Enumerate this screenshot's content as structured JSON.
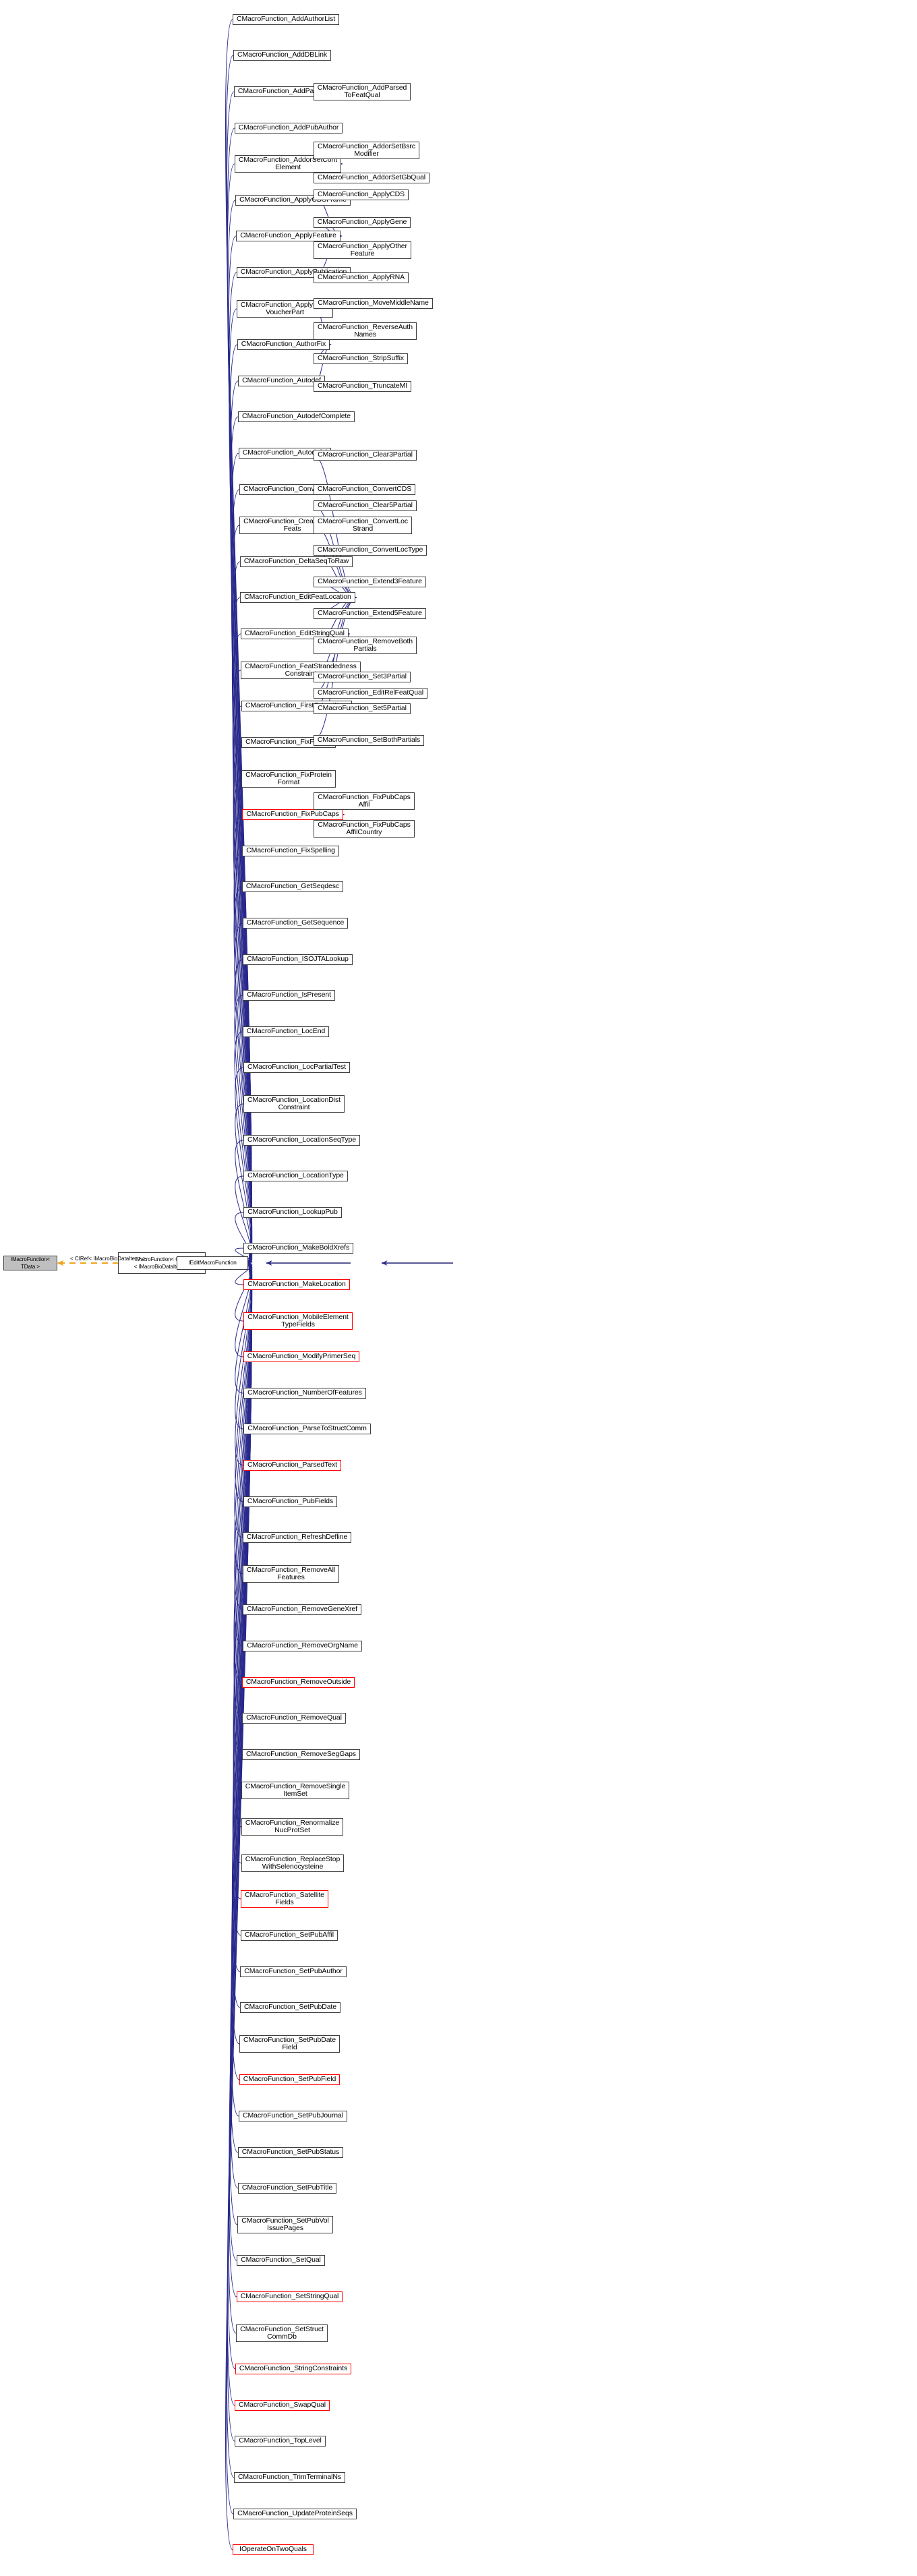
{
  "diagram": {
    "type": "inheritance-graph",
    "root": "IEditMacroFunction",
    "colors": {
      "node_border": "#404040",
      "node_fill": "#ffffff",
      "highlight_border": "#ff0000",
      "template_fill": "#bfbfbf",
      "inherit_edge": "#29298c",
      "usage_edge": "#f2a21c",
      "background": "#ffffff"
    },
    "edge_label": "< CIRef< IMacroBioDataIter > >",
    "base_chain": [
      {
        "label": "IMacroFunction< TData >",
        "style": "template"
      },
      {
        "label": "IMacroFunction< CIRef\n< IMacroBioDataIter > >",
        "style": "plain"
      },
      {
        "label": "IEditMacroFunction",
        "style": "plain"
      }
    ],
    "column1": [
      "CMacroFunction_AddAuthorList",
      "CMacroFunction_AddDBLink",
      "CMacroFunction_AddParsedText",
      "CMacroFunction_AddPubAuthor",
      "CMacroFunction_AddorSetCont\nElement",
      "CMacroFunction_ApplyCDSFrame",
      "CMacroFunction_ApplyFeature",
      "CMacroFunction_ApplyPublication",
      "CMacroFunction_ApplyStruc\nVoucherPart",
      "CMacroFunction_AuthorFix",
      "CMacroFunction_Autodef",
      "CMacroFunction_AutodefComplete",
      "CMacroFunction_AutodefId",
      "CMacroFunction_ConvertFeature",
      "CMacroFunction_CreateProtein\nFeats",
      "CMacroFunction_DeltaSeqToRaw",
      "CMacroFunction_EditFeatLocation",
      "CMacroFunction_EditStringQual",
      "CMacroFunction_FeatStrandedness\nConstraint",
      "CMacroFunction_FirstOrLastItem",
      "CMacroFunction_FixFormat",
      "CMacroFunction_FixProtein\nFormat",
      "CMacroFunction_FixPubCaps",
      "CMacroFunction_FixSpelling",
      "CMacroFunction_GetSeqdesc",
      "CMacroFunction_GetSequence",
      "CMacroFunction_ISOJTALookup",
      "CMacroFunction_IsPresent",
      "CMacroFunction_LocEnd",
      "CMacroFunction_LocPartialTest",
      "CMacroFunction_LocationDist\nConstraint",
      "CMacroFunction_LocationSeqType",
      "CMacroFunction_LocationType",
      "CMacroFunction_LookupPub",
      "CMacroFunction_MakeBoldXrefs",
      "CMacroFunction_MakeLocation",
      "CMacroFunction_MobileElement\nTypeFields",
      "CMacroFunction_ModifyPrimerSeq",
      "CMacroFunction_NumberOfFeatures",
      "CMacroFunction_ParseToStructComm",
      "CMacroFunction_ParsedText",
      "CMacroFunction_PubFields",
      "CMacroFunction_RefreshDefline",
      "CMacroFunction_RemoveAll\nFeatures",
      "CMacroFunction_RemoveGeneXref",
      "CMacroFunction_RemoveOrgName",
      "CMacroFunction_RemoveOutside",
      "CMacroFunction_RemoveQual",
      "CMacroFunction_RemoveSegGaps",
      "CMacroFunction_RemoveSingle\nItemSet",
      "CMacroFunction_Renormalize\nNucProtSet",
      "CMacroFunction_ReplaceStop\nWithSelenocysteine",
      "CMacroFunction_Satellite\nFields",
      "CMacroFunction_SetPubAffil",
      "CMacroFunction_SetPubAuthor",
      "CMacroFunction_SetPubDate",
      "CMacroFunction_SetPubDate\nField",
      "CMacroFunction_SetPubField",
      "CMacroFunction_SetPubJournal",
      "CMacroFunction_SetPubStatus",
      "CMacroFunction_SetPubTitle",
      "CMacroFunction_SetPubVol\nIssuePages",
      "CMacroFunction_SetQual",
      "CMacroFunction_SetStringQual",
      "CMacroFunction_SetStruct\nCommDb",
      "CMacroFunction_StringConstraints",
      "CMacroFunction_SwapQual",
      "CMacroFunction_TopLevel",
      "CMacroFunction_TrimTerminalNs",
      "CMacroFunction_UpdateProteinSeqs",
      "IOperateOnTwoQuals"
    ],
    "column1_red": [
      "CMacroFunction_FixPubCaps",
      "CMacroFunction_MakeLocation",
      "CMacroFunction_MobileElement\nTypeFields",
      "CMacroFunction_ModifyPrimerSeq",
      "CMacroFunction_ParsedText",
      "CMacroFunction_RemoveOutside",
      "CMacroFunction_Satellite\nFields",
      "CMacroFunction_SetPubField",
      "CMacroFunction_SetStringQual",
      "CMacroFunction_StringConstraints",
      "CMacroFunction_SwapQual",
      "IOperateOnTwoQuals"
    ],
    "column2": [
      "CMacroFunction_AddParsed\nToFeatQual",
      "CMacroFunction_AddorSetBsrc\nModifier",
      "CMacroFunction_AddorSetGbQual",
      "CMacroFunction_ApplyCDS",
      "CMacroFunction_ApplyGene",
      "CMacroFunction_ApplyOther\nFeature",
      "CMacroFunction_ApplyRNA",
      "CMacroFunction_MoveMiddleName",
      "CMacroFunction_ReverseAuth\nNames",
      "CMacroFunction_StripSuffix",
      "CMacroFunction_TruncateMI",
      "CMacroFunction_ConvertCDS",
      "CMacroFunction_Clear3Partial",
      "CMacroFunction_Clear5Partial",
      "CMacroFunction_ConvertLoc\nStrand",
      "CMacroFunction_ConvertLocType",
      "CMacroFunction_Extend3Feature",
      "CMacroFunction_Extend5Feature",
      "CMacroFunction_RemoveBoth\nPartials",
      "CMacroFunction_Set3Partial",
      "CMacroFunction_Set5Partial",
      "CMacroFunction_SetBothPartials",
      "CMacroFunction_EditRelFeatQual",
      "CMacroFunction_FixPubCaps\nAffil",
      "CMacroFunction_FixPubCaps\nAffilCountry"
    ],
    "column2_parents": {
      "CMacroFunction_AddParsed\nToFeatQual": "CMacroFunction_AddParsedText",
      "CMacroFunction_AddorSetBsrc\nModifier": "CMacroFunction_AddorSetCont\nElement",
      "CMacroFunction_AddorSetGbQual": "CMacroFunction_AddorSetCont\nElement",
      "CMacroFunction_ApplyCDS": "CMacroFunction_ApplyFeature",
      "CMacroFunction_ApplyGene": "CMacroFunction_ApplyFeature",
      "CMacroFunction_ApplyOther\nFeature": "CMacroFunction_ApplyFeature",
      "CMacroFunction_ApplyRNA": "CMacroFunction_ApplyFeature",
      "CMacroFunction_MoveMiddleName": "CMacroFunction_AuthorFix",
      "CMacroFunction_ReverseAuth\nNames": "CMacroFunction_AuthorFix",
      "CMacroFunction_StripSuffix": "CMacroFunction_AuthorFix",
      "CMacroFunction_TruncateMI": "CMacroFunction_AuthorFix",
      "CMacroFunction_ConvertCDS": "CMacroFunction_ConvertFeature",
      "CMacroFunction_Clear3Partial": "CMacroFunction_EditFeatLocation",
      "CMacroFunction_Clear5Partial": "CMacroFunction_EditFeatLocation",
      "CMacroFunction_ConvertLoc\nStrand": "CMacroFunction_EditFeatLocation",
      "CMacroFunction_ConvertLocType": "CMacroFunction_EditFeatLocation",
      "CMacroFunction_Extend3Feature": "CMacroFunction_EditFeatLocation",
      "CMacroFunction_Extend5Feature": "CMacroFunction_EditFeatLocation",
      "CMacroFunction_RemoveBoth\nPartials": "CMacroFunction_EditFeatLocation",
      "CMacroFunction_Set3Partial": "CMacroFunction_EditFeatLocation",
      "CMacroFunction_Set5Partial": "CMacroFunction_EditFeatLocation",
      "CMacroFunction_SetBothPartials": "CMacroFunction_EditFeatLocation",
      "CMacroFunction_EditRelFeatQual": "CMacroFunction_EditStringQual",
      "CMacroFunction_FixPubCaps\nAffil": "CMacroFunction_FixPubCaps",
      "CMacroFunction_FixPubCaps\nAffilCountry": "CMacroFunction_FixPubCaps"
    }
  }
}
